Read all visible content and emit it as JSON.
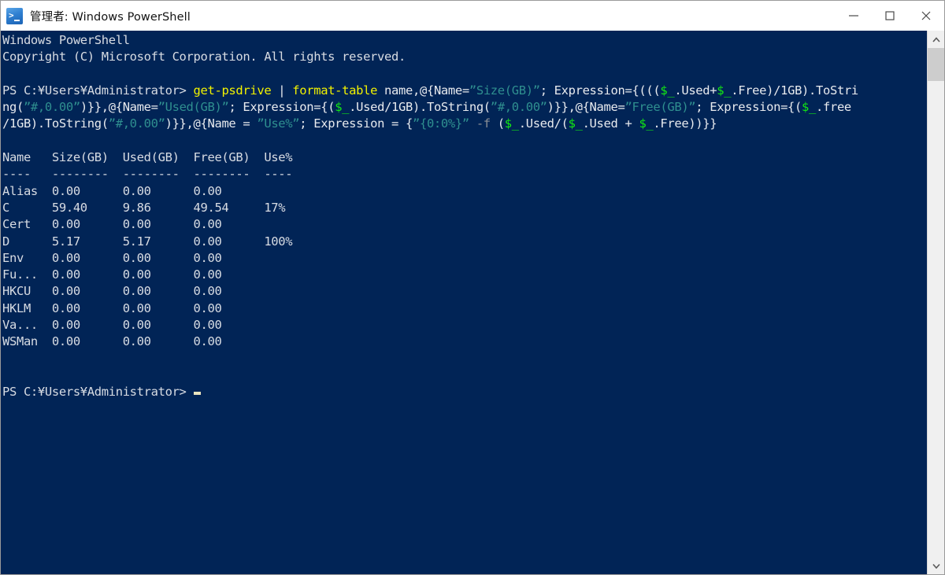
{
  "window": {
    "title": "管理者: Windows PowerShell",
    "icon": "powershell-icon",
    "controls": {
      "minimize": "–",
      "maximize": "☐",
      "close": "×"
    },
    "background_color": "#012456",
    "titlebar_color": "#ffffff"
  },
  "colors": {
    "console_background": "#012456",
    "default_text": "#d6dbe3",
    "cmdlet": "#f2f200",
    "string": "#2f8f8f",
    "variable": "#13e813",
    "operator": "#e8eaee",
    "parameter": "#8c8f96",
    "cursor": "#e9e4bf"
  },
  "console": {
    "banner": [
      "Windows PowerShell",
      "Copyright (C) Microsoft Corporation. All rights reserved."
    ],
    "prompt": "PS C:\\Users\\Administrator>",
    "prompt_display": "PS C:¥Users¥Administrator>",
    "command_tokens_line1": [
      {
        "text": "PS C:¥Users¥Administrator> ",
        "type": "out"
      },
      {
        "text": "get-psdrive",
        "type": "cmdlet"
      },
      {
        "text": " | ",
        "type": "operator"
      },
      {
        "text": "format-table",
        "type": "cmdlet"
      },
      {
        "text": " name,",
        "type": "operator"
      },
      {
        "text": "@{Name=",
        "type": "operator"
      },
      {
        "text": "”Size(GB)”",
        "type": "string"
      },
      {
        "text": "; Expression={(((",
        "type": "operator"
      },
      {
        "text": "$_",
        "type": "variable"
      },
      {
        "text": ".Used+",
        "type": "operator"
      },
      {
        "text": "$_",
        "type": "variable"
      },
      {
        "text": ".Free)/1GB).ToStri",
        "type": "operator"
      }
    ],
    "command_tokens_line2": [
      {
        "text": "ng(",
        "type": "operator"
      },
      {
        "text": "”#,0.00”",
        "type": "string"
      },
      {
        "text": ")}},@{Name=",
        "type": "operator"
      },
      {
        "text": "”Used(GB)”",
        "type": "string"
      },
      {
        "text": "; Expression={(",
        "type": "operator"
      },
      {
        "text": "$_",
        "type": "variable"
      },
      {
        "text": ".Used/1GB).ToString(",
        "type": "operator"
      },
      {
        "text": "”#,0.00”",
        "type": "string"
      },
      {
        "text": ")}},@{Name=",
        "type": "operator"
      },
      {
        "text": "”Free(GB)”",
        "type": "string"
      },
      {
        "text": "; Expression={(",
        "type": "operator"
      },
      {
        "text": "$_",
        "type": "variable"
      },
      {
        "text": ".free",
        "type": "operator"
      }
    ],
    "command_tokens_line3": [
      {
        "text": "/1GB).ToString(",
        "type": "operator"
      },
      {
        "text": "”#,0.00”",
        "type": "string"
      },
      {
        "text": ")}},@{Name = ",
        "type": "operator"
      },
      {
        "text": "”Use%”",
        "type": "string"
      },
      {
        "text": "; Expression = {",
        "type": "operator"
      },
      {
        "text": "”{0:0%}”",
        "type": "string"
      },
      {
        "text": " -f",
        "type": "parameter"
      },
      {
        "text": " (",
        "type": "operator"
      },
      {
        "text": "$_",
        "type": "variable"
      },
      {
        "text": ".Used/(",
        "type": "operator"
      },
      {
        "text": "$_",
        "type": "variable"
      },
      {
        "text": ".Used + ",
        "type": "operator"
      },
      {
        "text": "$_",
        "type": "variable"
      },
      {
        "text": ".Free))}}",
        "type": "operator"
      }
    ],
    "table": {
      "header": "Name   Size(GB)  Used(GB)  Free(GB)  Use%",
      "separator": "----   --------  --------  --------  ----",
      "columns": [
        "Name",
        "Size(GB)",
        "Used(GB)",
        "Free(GB)",
        "Use%"
      ],
      "rows": [
        {
          "name": "Alias",
          "size": "0.00",
          "used": "0.00",
          "free": "0.00",
          "use": ""
        },
        {
          "name": "C",
          "size": "59.40",
          "used": "9.86",
          "free": "49.54",
          "use": "17%"
        },
        {
          "name": "Cert",
          "size": "0.00",
          "used": "0.00",
          "free": "0.00",
          "use": ""
        },
        {
          "name": "D",
          "size": "5.17",
          "used": "5.17",
          "free": "0.00",
          "use": "100%"
        },
        {
          "name": "Env",
          "size": "0.00",
          "used": "0.00",
          "free": "0.00",
          "use": ""
        },
        {
          "name": "Fu...",
          "size": "0.00",
          "used": "0.00",
          "free": "0.00",
          "use": ""
        },
        {
          "name": "HKCU",
          "size": "0.00",
          "used": "0.00",
          "free": "0.00",
          "use": ""
        },
        {
          "name": "HKLM",
          "size": "0.00",
          "used": "0.00",
          "free": "0.00",
          "use": ""
        },
        {
          "name": "Va...",
          "size": "0.00",
          "used": "0.00",
          "free": "0.00",
          "use": ""
        },
        {
          "name": "WSMan",
          "size": "0.00",
          "used": "0.00",
          "free": "0.00",
          "use": ""
        }
      ],
      "rows_text": [
        "Alias  0.00      0.00      0.00      ",
        "C      59.40     9.86      49.54     17%",
        "Cert   0.00      0.00      0.00      ",
        "D      5.17      5.17      0.00      100%",
        "Env    0.00      0.00      0.00      ",
        "Fu...  0.00      0.00      0.00      ",
        "HKCU   0.00      0.00      0.00      ",
        "HKLM   0.00      0.00      0.00      ",
        "Va...  0.00      0.00      0.00      ",
        "WSMan  0.00      0.00      0.00      "
      ]
    },
    "final_prompt": "PS C:¥Users¥Administrator> "
  },
  "scrollbar": {
    "up_arrow": "⌃",
    "down_arrow": "⌄"
  }
}
